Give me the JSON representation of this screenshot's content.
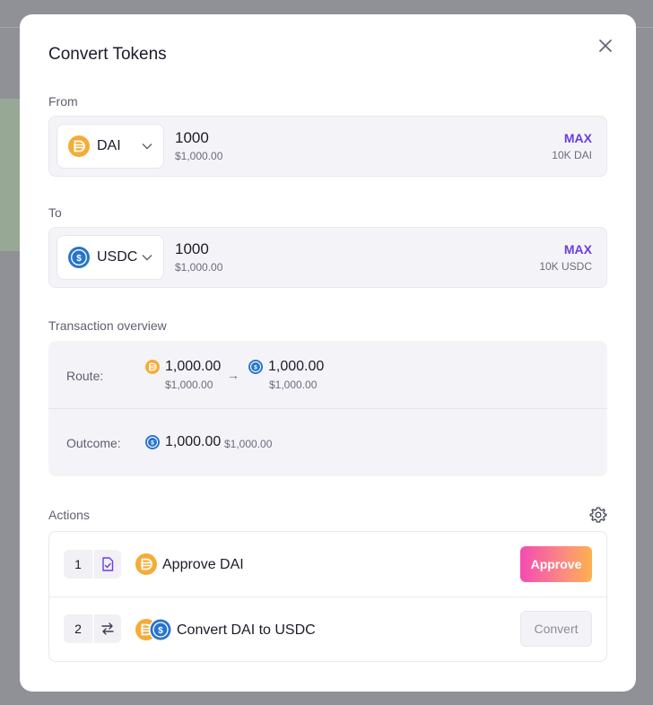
{
  "modal": {
    "title": "Convert Tokens"
  },
  "from": {
    "label": "From",
    "token": "DAI",
    "amount": "1000",
    "usd": "$1,000.00",
    "max_label": "MAX",
    "balance": "10K DAI"
  },
  "to": {
    "label": "To",
    "token": "USDC",
    "amount": "1000",
    "usd": "$1,000.00",
    "max_label": "MAX",
    "balance": "10K USDC"
  },
  "overview": {
    "label": "Transaction overview",
    "route_label": "Route:",
    "route_from_amount": "1,000.00",
    "route_from_usd": "$1,000.00",
    "route_arrow": "→",
    "route_to_amount": "1,000.00",
    "route_to_usd": "$1,000.00",
    "outcome_label": "Outcome:",
    "outcome_amount": "1,000.00",
    "outcome_usd": "$1,000.00"
  },
  "actions": {
    "label": "Actions",
    "steps": [
      {
        "number": "1",
        "title": "Approve DAI",
        "button": "Approve",
        "icon": "file-check-icon"
      },
      {
        "number": "2",
        "title": "Convert DAI to USDC",
        "button": "Convert",
        "icon": "swap-arrows-icon"
      }
    ]
  },
  "colors": {
    "dai": "#f5ac37",
    "usdc": "#2775ca",
    "accent": "#6c3ce0",
    "approve_gradient_start": "#f44bb0",
    "approve_gradient_end": "#fdb14e"
  }
}
